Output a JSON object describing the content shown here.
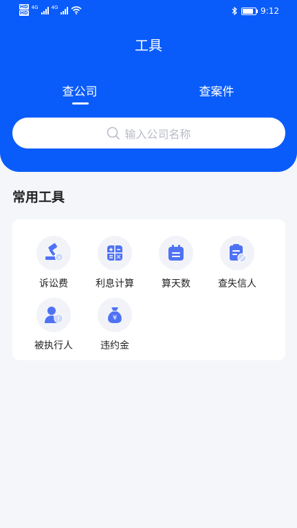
{
  "status_bar": {
    "hd1": "HD",
    "hd2": "HD",
    "net1": "4G",
    "net2": "4G",
    "time": "9:12"
  },
  "header": {
    "title": "工具",
    "tabs": [
      {
        "label": "查公司",
        "active": true
      },
      {
        "label": "查案件",
        "active": false
      }
    ],
    "accent_color": "#0a5cfa"
  },
  "search": {
    "placeholder": "输入公司名称",
    "icon": "search-icon"
  },
  "tools_section": {
    "title": "常用工具",
    "items": [
      {
        "label": "诉讼费",
        "icon": "gavel-yuan-icon"
      },
      {
        "label": "利息计算",
        "icon": "calculator-icon"
      },
      {
        "label": "算天数",
        "icon": "calendar-icon"
      },
      {
        "label": "查失信人",
        "icon": "blacklist-document-icon"
      },
      {
        "label": "被执行人",
        "icon": "person-alert-icon"
      },
      {
        "label": "违约金",
        "icon": "money-bag-icon"
      }
    ]
  }
}
